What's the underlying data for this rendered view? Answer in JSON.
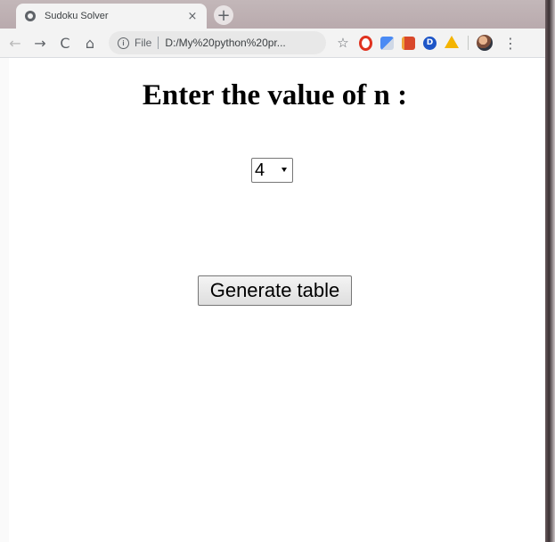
{
  "browser": {
    "tab_title": "Sudoku Solver",
    "tab_close_glyph": "×",
    "new_tab_glyph": "+",
    "url_scheme": "File",
    "url": "D:/My%20python%20pr...",
    "back_icon": "←",
    "forward_icon": "→",
    "reload_icon": "C",
    "home_icon": "⌂",
    "star_icon": "☆",
    "menu_icon": "⋮",
    "extensions": [
      "opera-icon",
      "translate-icon",
      "book-icon",
      "dmark-icon",
      "drive-icon"
    ],
    "extension_dmark_letter": "D"
  },
  "page": {
    "heading": "Enter the value of n :",
    "select": {
      "selected_value": "4"
    },
    "generate_button_label": "Generate table"
  },
  "colors": {
    "titlebar": "#bcaeb1",
    "toolbar": "#f3f3f3",
    "opera_red": "#e0321f",
    "dmark_blue": "#1d55c7",
    "drive_yellow": "#f4b400"
  }
}
